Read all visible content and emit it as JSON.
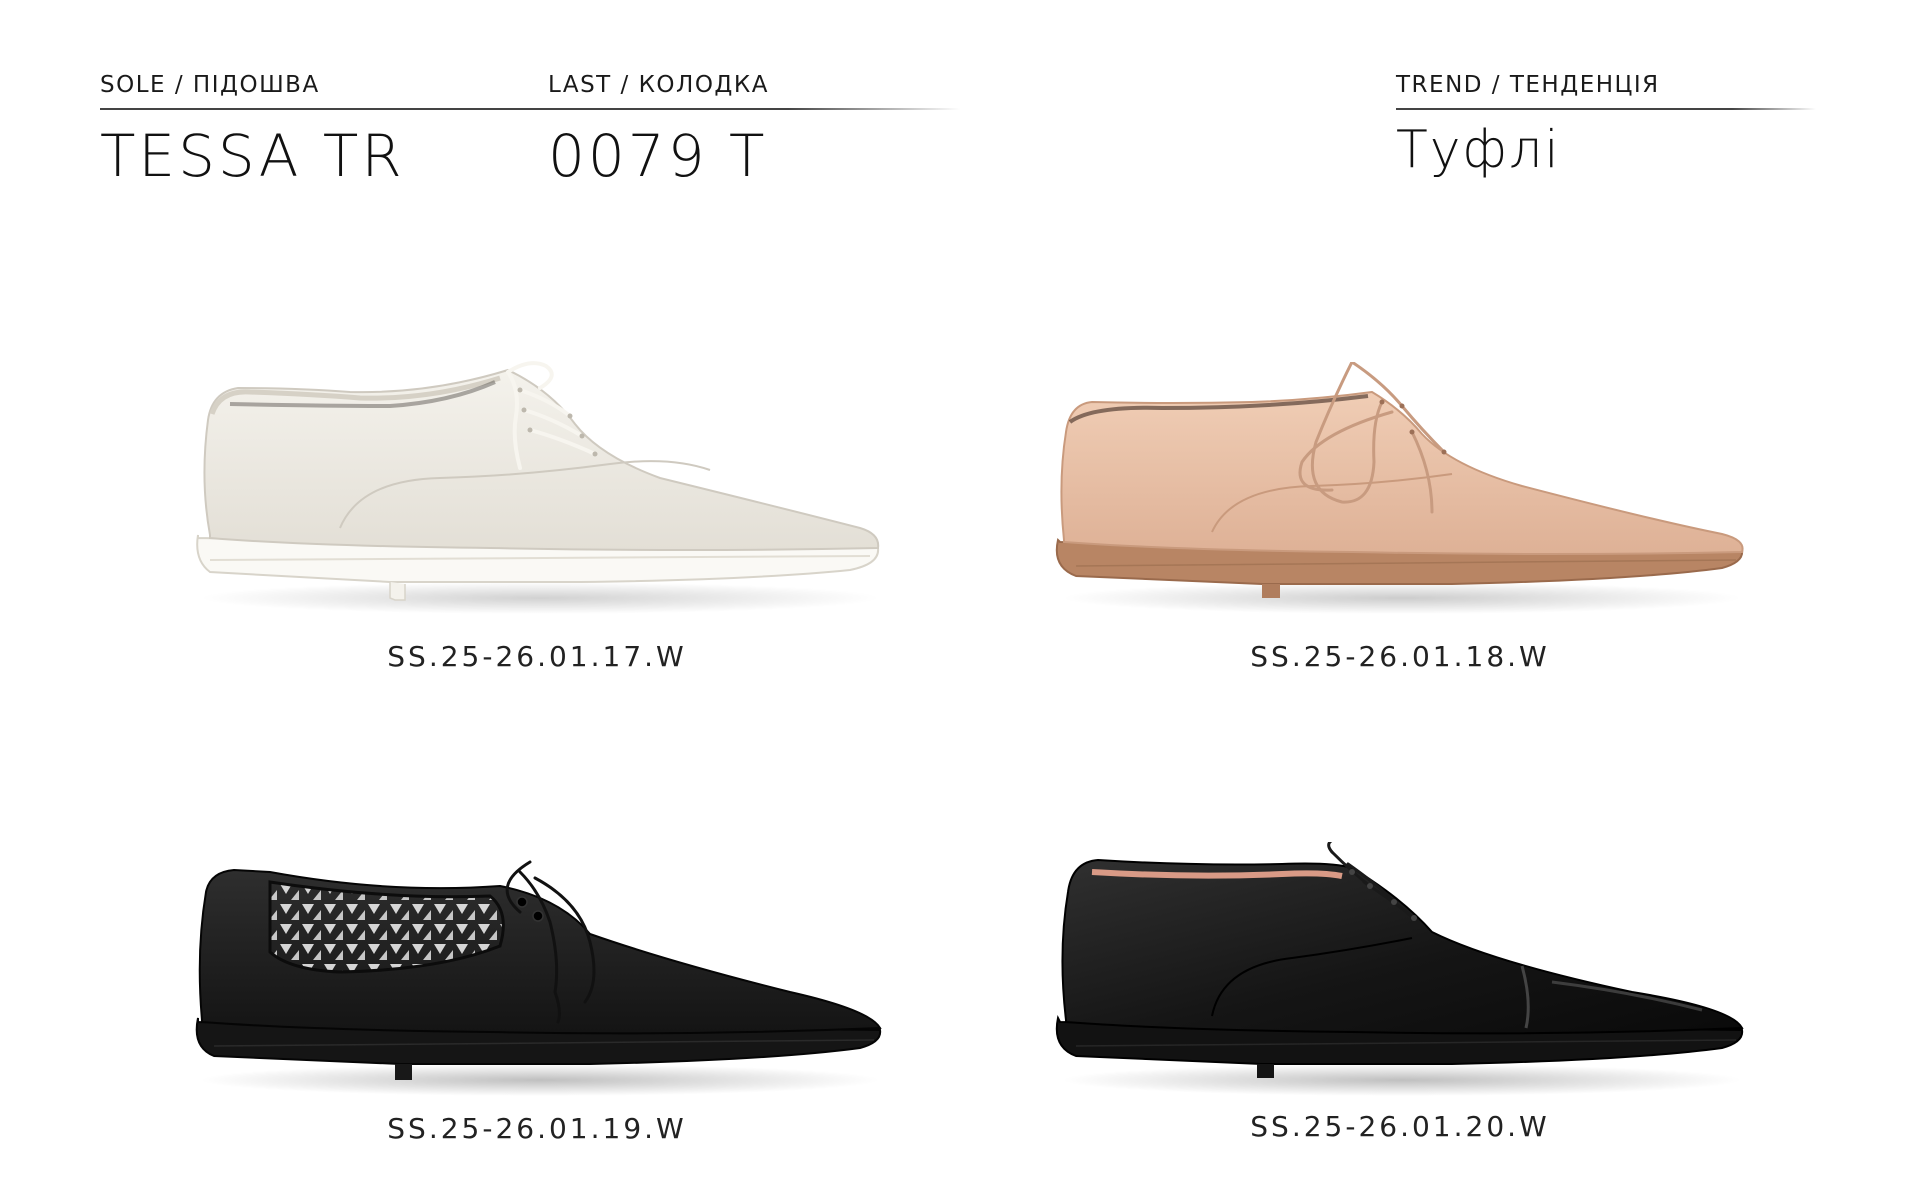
{
  "header": {
    "sole_label": "SOLE / ПІДОШВА",
    "sole_value": "TESSA TR",
    "last_label": "LAST / КОЛОДКА",
    "last_value": "0079 T",
    "trend_label": "TREND / ТЕНДЕНЦІЯ",
    "trend_value": "Туфлі"
  },
  "products": [
    {
      "code": "SS.25-26.01.17.W",
      "color": "#ece9e2",
      "color_name": "ivory",
      "icon": "lace-up-shoe-icon"
    },
    {
      "code": "SS.25-26.01.18.W",
      "color": "#e8c2a7",
      "color_name": "nude",
      "icon": "lace-up-shoe-icon"
    },
    {
      "code": "SS.25-26.01.19.W",
      "color": "#1c1c1c",
      "color_name": "black perforated",
      "icon": "lace-up-shoe-icon"
    },
    {
      "code": "SS.25-26.01.20.W",
      "color": "#151515",
      "color_name": "black",
      "icon": "lace-up-shoe-icon"
    }
  ]
}
